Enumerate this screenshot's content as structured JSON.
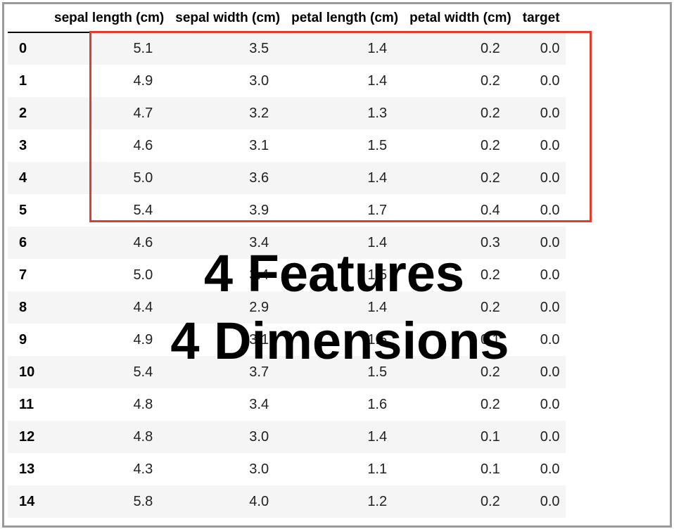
{
  "columns": [
    "sepal length (cm)",
    "sepal width (cm)",
    "petal length (cm)",
    "petal width (cm)",
    "target"
  ],
  "rows": [
    {
      "index": "0",
      "values": [
        "5.1",
        "3.5",
        "1.4",
        "0.2",
        "0.0"
      ]
    },
    {
      "index": "1",
      "values": [
        "4.9",
        "3.0",
        "1.4",
        "0.2",
        "0.0"
      ]
    },
    {
      "index": "2",
      "values": [
        "4.7",
        "3.2",
        "1.3",
        "0.2",
        "0.0"
      ]
    },
    {
      "index": "3",
      "values": [
        "4.6",
        "3.1",
        "1.5",
        "0.2",
        "0.0"
      ]
    },
    {
      "index": "4",
      "values": [
        "5.0",
        "3.6",
        "1.4",
        "0.2",
        "0.0"
      ]
    },
    {
      "index": "5",
      "values": [
        "5.4",
        "3.9",
        "1.7",
        "0.4",
        "0.0"
      ]
    },
    {
      "index": "6",
      "values": [
        "4.6",
        "3.4",
        "1.4",
        "0.3",
        "0.0"
      ]
    },
    {
      "index": "7",
      "values": [
        "5.0",
        "3.4",
        "1.5",
        "0.2",
        "0.0"
      ]
    },
    {
      "index": "8",
      "values": [
        "4.4",
        "2.9",
        "1.4",
        "0.2",
        "0.0"
      ]
    },
    {
      "index": "9",
      "values": [
        "4.9",
        "3.1",
        "1.5",
        "0.1",
        "0.0"
      ]
    },
    {
      "index": "10",
      "values": [
        "5.4",
        "3.7",
        "1.5",
        "0.2",
        "0.0"
      ]
    },
    {
      "index": "11",
      "values": [
        "4.8",
        "3.4",
        "1.6",
        "0.2",
        "0.0"
      ]
    },
    {
      "index": "12",
      "values": [
        "4.8",
        "3.0",
        "1.4",
        "0.1",
        "0.0"
      ]
    },
    {
      "index": "13",
      "values": [
        "4.3",
        "3.0",
        "1.1",
        "0.1",
        "0.0"
      ]
    },
    {
      "index": "14",
      "values": [
        "5.8",
        "4.0",
        "1.2",
        "0.2",
        "0.0"
      ]
    }
  ],
  "overlay": {
    "line1": "4 Features",
    "line2": "4 Dimensions"
  },
  "colors": {
    "highlight": "#e23c2e",
    "frame": "#9a9a9a",
    "stripe": "#f5f5f5"
  }
}
